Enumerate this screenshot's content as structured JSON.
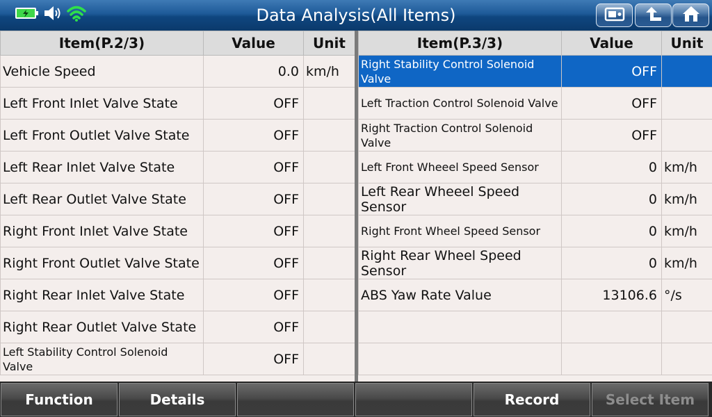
{
  "header": {
    "title": "Data Analysis(All Items)",
    "icons": [
      "battery-charging-icon",
      "speaker-icon",
      "wifi-icon",
      "screenshot-icon",
      "back-arrow-icon",
      "home-icon"
    ]
  },
  "left_table": {
    "headers": [
      "Item(P.2/3)",
      "Value",
      "Unit"
    ],
    "rows": [
      {
        "item": "Vehicle Speed",
        "value": "0.0",
        "unit": "km/h"
      },
      {
        "item": "Left Front Inlet Valve State",
        "value": "OFF",
        "unit": ""
      },
      {
        "item": "Left Front Outlet Valve State",
        "value": "OFF",
        "unit": ""
      },
      {
        "item": "Left Rear Inlet Valve State",
        "value": "OFF",
        "unit": ""
      },
      {
        "item": "Left Rear Outlet Valve State",
        "value": "OFF",
        "unit": ""
      },
      {
        "item": "Right Front Inlet Valve State",
        "value": "OFF",
        "unit": ""
      },
      {
        "item": "Right Front Outlet Valve State",
        "value": "OFF",
        "unit": ""
      },
      {
        "item": "Right Rear Inlet Valve State",
        "value": "OFF",
        "unit": ""
      },
      {
        "item": "Right Rear Outlet Valve State",
        "value": "OFF",
        "unit": ""
      },
      {
        "item": "Left Stability Control Solenoid Valve",
        "value": "OFF",
        "unit": ""
      }
    ]
  },
  "right_table": {
    "headers": [
      "Item(P.3/3)",
      "Value",
      "Unit"
    ],
    "rows": [
      {
        "item": "Right Stability Control Solenoid Valve",
        "value": "OFF",
        "unit": "",
        "selected": true
      },
      {
        "item": "Left Traction Control Solenoid Valve",
        "value": "OFF",
        "unit": ""
      },
      {
        "item": "Right Traction Control Solenoid Valve",
        "value": "OFF",
        "unit": ""
      },
      {
        "item": "Left Front Wheeel Speed Sensor",
        "value": "0",
        "unit": "km/h"
      },
      {
        "item": "Left Rear Wheeel Speed Sensor",
        "value": "0",
        "unit": "km/h"
      },
      {
        "item": "Right Front Wheel Speed Sensor",
        "value": "0",
        "unit": "km/h"
      },
      {
        "item": "Right Rear Wheel Speed Sensor",
        "value": "0",
        "unit": "km/h"
      },
      {
        "item": "ABS Yaw Rate Value",
        "value": "13106.6",
        "unit": "°/s"
      },
      {
        "item": "",
        "value": "",
        "unit": ""
      },
      {
        "item": "",
        "value": "",
        "unit": ""
      }
    ]
  },
  "bottom_bar": {
    "buttons": [
      {
        "label": "Function",
        "enabled": true
      },
      {
        "label": "Details",
        "enabled": true
      },
      {
        "label": "",
        "enabled": true
      },
      {
        "label": "",
        "enabled": true
      },
      {
        "label": "Record",
        "enabled": true
      },
      {
        "label": "Select Item",
        "enabled": false
      }
    ]
  },
  "colors": {
    "header_blue": "#1d5a98",
    "selected_row": "#0f66c5",
    "row_bg": "#f4eeec",
    "battery_green": "#3fd64a",
    "wifi_green": "#2fe04a"
  }
}
